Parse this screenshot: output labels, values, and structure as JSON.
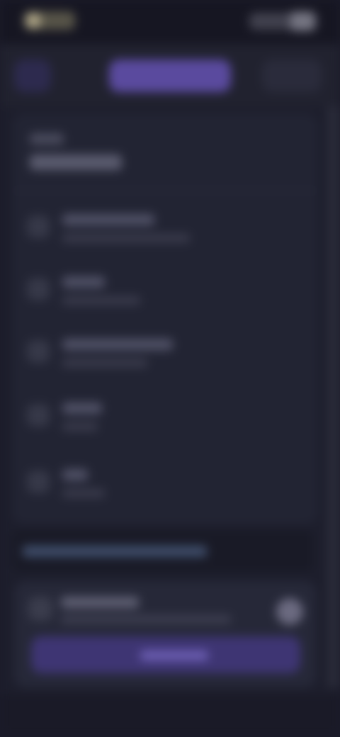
{
  "status_bar": {
    "time": "",
    "icons": ""
  },
  "tabs": [
    {
      "label": ""
    },
    {
      "label": ""
    },
    {
      "label": ""
    }
  ],
  "card": {
    "header": {
      "kicker": "",
      "title": ""
    },
    "rows": [
      {
        "title": "",
        "subtitle": ""
      },
      {
        "title": "",
        "subtitle": ""
      },
      {
        "title": "",
        "subtitle": ""
      },
      {
        "title": "",
        "subtitle": ""
      },
      {
        "title": "",
        "subtitle": ""
      }
    ]
  },
  "banner": {
    "text": ""
  },
  "panel": {
    "title": "",
    "subtitle": "",
    "button_label": ""
  },
  "colors": {
    "background": "#1d1e2c",
    "accent": "#5a4a9e",
    "card": "#222433"
  }
}
